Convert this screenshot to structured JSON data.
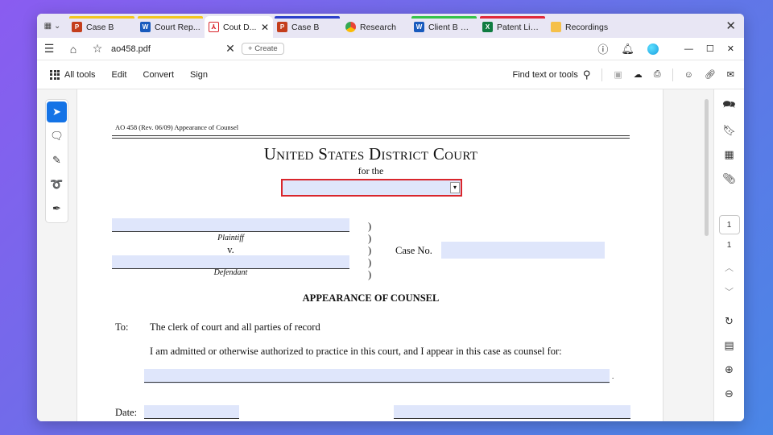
{
  "tabs": [
    {
      "label": "Case B",
      "icon": "PowerPoint",
      "accent": "#f2c61f",
      "active": false
    },
    {
      "label": "Court Rep...",
      "icon": "Word",
      "accent": "#f2c61f",
      "active": false
    },
    {
      "label": "Cout D...",
      "icon": "Acrobat",
      "accent": "",
      "active": true
    },
    {
      "label": "Case B",
      "icon": "PowerPoint",
      "accent": "#2b3fc9",
      "active": false
    },
    {
      "label": "Research",
      "icon": "Chrome",
      "accent": "",
      "active": false
    },
    {
      "label": "Client B M...",
      "icon": "Word",
      "accent": "#35c24a",
      "active": false
    },
    {
      "label": "Patent List...",
      "icon": "Excel",
      "accent": "#e0293a",
      "active": false
    },
    {
      "label": "Recordings",
      "icon": "Folder",
      "accent": "",
      "active": false
    }
  ],
  "docbar": {
    "filename": "ao458.pdf",
    "create_label": "Create"
  },
  "toolbar": {
    "all_tools": "All tools",
    "edit": "Edit",
    "convert": "Convert",
    "sign": "Sign",
    "find": "Find text or tools"
  },
  "page_nav": {
    "current": "1",
    "total": "1"
  },
  "document": {
    "header": "AO 458 (Rev. 06/09)  Appearance of Counsel",
    "court_title": "United States District Court",
    "for_the": "for the",
    "plaintiff_label": "Plaintiff",
    "versus": "v.",
    "defendant_label": "Defendant",
    "paren": ")",
    "case_no_label": "Case No.",
    "section_title": "APPEARANCE OF COUNSEL",
    "to_label": "To:",
    "to_text": "The clerk of court and all parties of record",
    "admission_text": "I am admitted or otherwise authorized to practice in this court, and I appear in this case as counsel for:",
    "date_label": "Date:"
  },
  "colors": {
    "accent_blue": "#1473e6",
    "field_fill": "#dfe6fb",
    "dropdown_border": "#d9262c"
  }
}
